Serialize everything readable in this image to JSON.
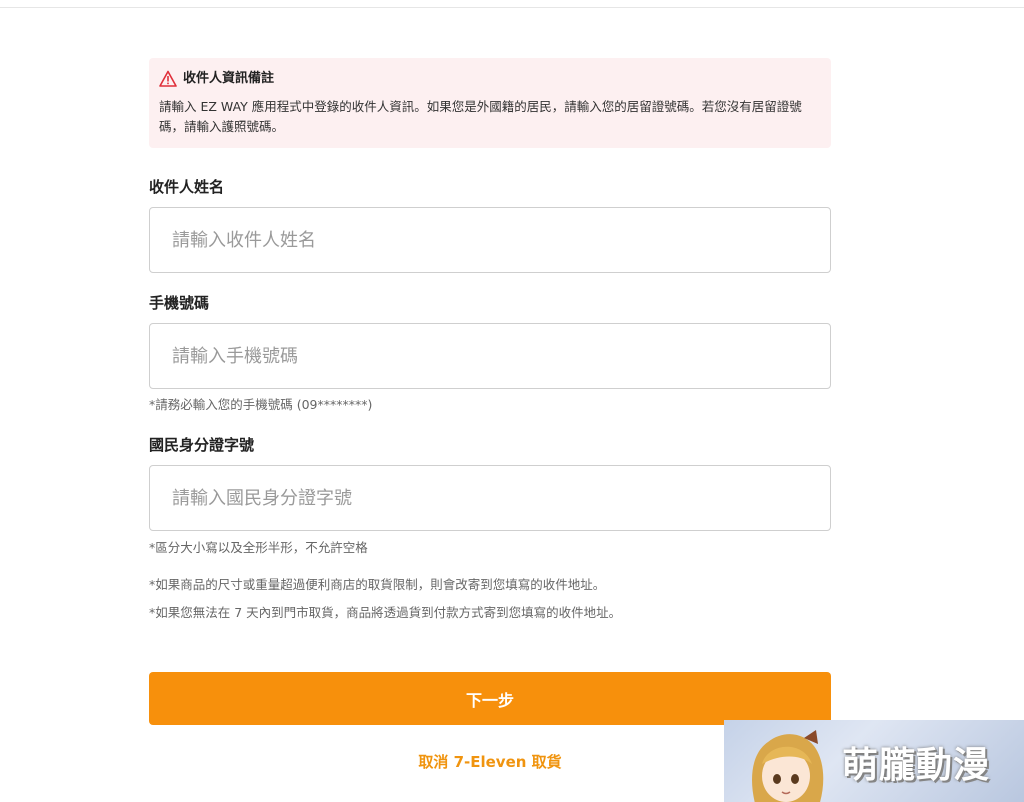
{
  "notice": {
    "title": "收件人資訊備註",
    "text": "請輸入 EZ WAY 應用程式中登錄的收件人資訊。如果您是外國籍的居民，請輸入您的居留證號碼。若您沒有居留證號碼，請輸入護照號碼。"
  },
  "fields": {
    "name": {
      "label": "收件人姓名",
      "placeholder": "請輸入收件人姓名",
      "value": ""
    },
    "phone": {
      "label": "手機號碼",
      "placeholder": "請輸入手機號碼",
      "value": "",
      "hint": "*請務必輸入您的手機號碼 (09********)"
    },
    "id": {
      "label": "國民身分證字號",
      "placeholder": "請輸入國民身分證字號",
      "value": "",
      "hint": "*區分大小寫以及全形半形，不允許空格"
    }
  },
  "notes": [
    "*如果商品的尺寸或重量超過便利商店的取貨限制，則會改寄到您填寫的收件地址。",
    "*如果您無法在 7 天內到門市取貨，商品將透過貨到付款方式寄到您填寫的收件地址。"
  ],
  "actions": {
    "next_label": "下一步",
    "cancel_label": "取消 7-Eleven 取貨"
  },
  "watermark": {
    "text": "萌朧動漫"
  },
  "colors": {
    "accent": "#f7900c",
    "notice_bg": "#fdf0f1",
    "warning": "#e02f3a"
  }
}
